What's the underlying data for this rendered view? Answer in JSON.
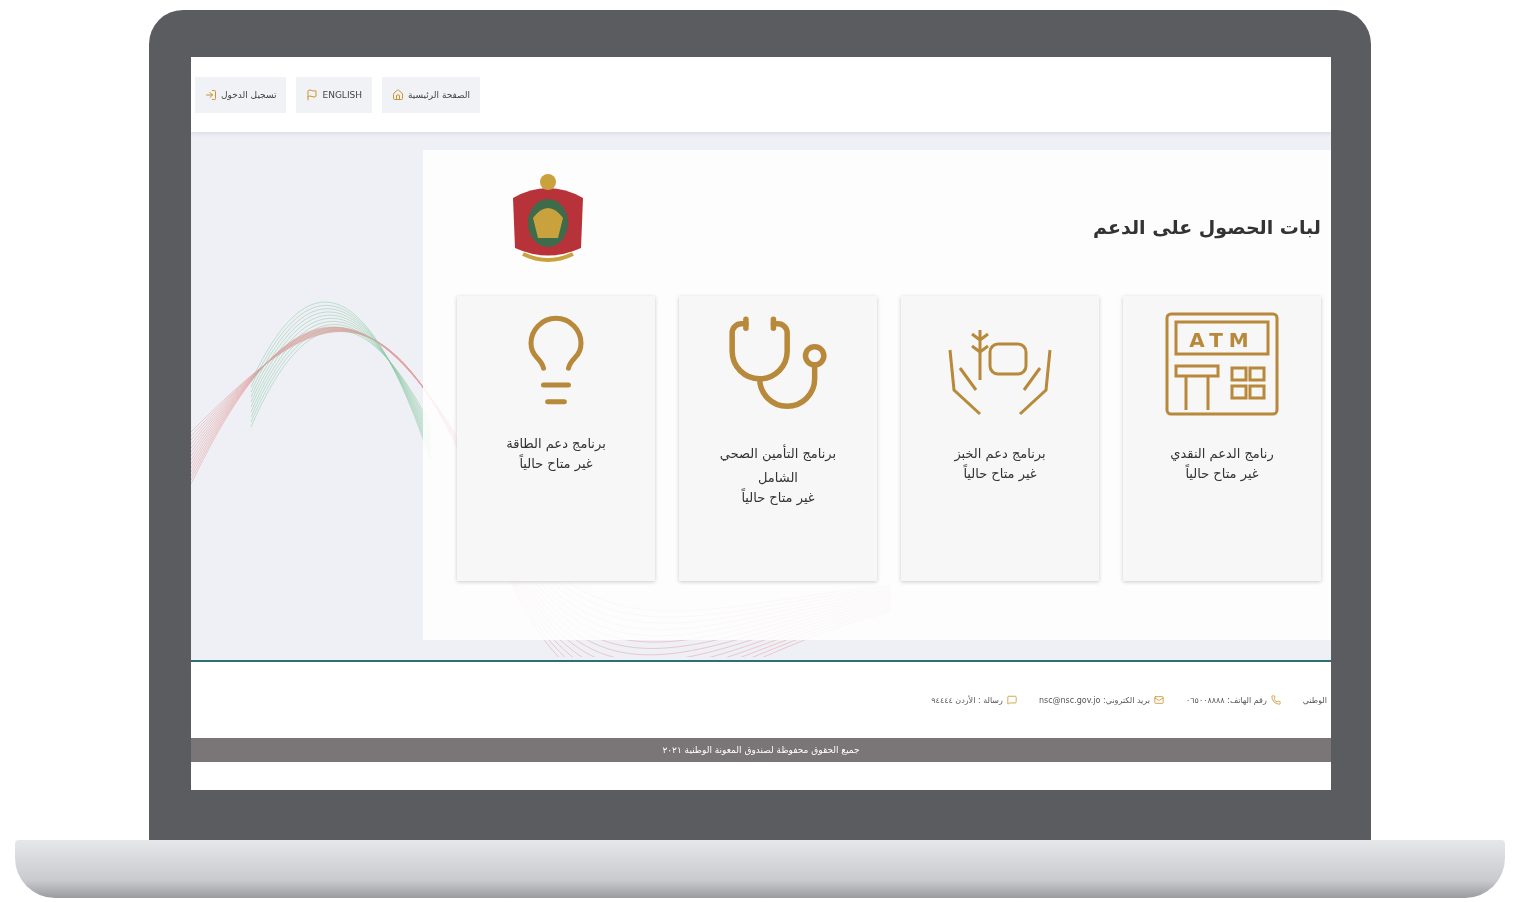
{
  "nav": [
    {
      "label": "الصفحة الرئيسية",
      "kind": "home"
    },
    {
      "label": "ENGLISH",
      "kind": "flag"
    },
    {
      "label": "تسجيل الدخول",
      "kind": "login"
    }
  ],
  "title": "لبات الحصول على الدعم",
  "cards": [
    {
      "kind": "atm",
      "icon_text": "ATM",
      "title": "رنامج الدعم النقدي",
      "status": "غير متاح حالياً"
    },
    {
      "kind": "bread",
      "title": "برنامج دعم الخبز",
      "status": "غير متاح حالياً"
    },
    {
      "kind": "health",
      "title": "برنامج التأمين الصحي الشامل",
      "status": "غير متاح حالياً"
    },
    {
      "kind": "energy",
      "title": "برنامج دعم الطاقة",
      "status": "غير متاح حالياً"
    }
  ],
  "footer": {
    "contacts": [
      {
        "kind": "plain",
        "text": "الوطني"
      },
      {
        "kind": "phone",
        "text": "رقم الهاتف: ٠٦٥٠٠٨٨٨٨"
      },
      {
        "kind": "mail",
        "text": "بريد الكتروني: nsc@nsc.gov.jo"
      },
      {
        "kind": "post",
        "text": "رسالة : الأردن ٩٤٤٤٤"
      }
    ],
    "copyright": "جميع الحقوق محفوظة لصندوق المعونة الوطنية ٢٠٢١"
  }
}
